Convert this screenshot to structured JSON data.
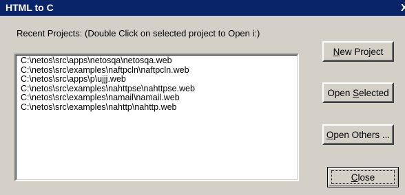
{
  "window": {
    "title": "HTML to C",
    "close_glyph": "X"
  },
  "prompt": "Recent Projects: (Double Click on selected project to Open i:)",
  "projects": [
    "C:\\netos\\src\\apps\\netosqa\\netosqa.web",
    "C:\\netos\\src\\examples\\naftpcln\\naftpcln.web",
    "C:\\netos\\src\\apps\\p\\ujjj.web",
    "C:\\netos\\src\\examples\\nahttpse\\nahttpse.web",
    "C:\\netos\\src\\examples\\namail\\namail.web",
    "C:\\netos\\src\\examples\\nahttp\\nahttp.web"
  ],
  "buttons": {
    "new_project": {
      "mnemonic": "N",
      "rest": "ew Project"
    },
    "open_selected": {
      "pre": "Open ",
      "mnemonic": "S",
      "rest": "elected"
    },
    "open_others": {
      "mnemonic": "O",
      "rest": "pen Others ..."
    },
    "close": {
      "mnemonic": "C",
      "rest": "lose"
    }
  },
  "colors": {
    "titlebar": "#0a246a",
    "face": "#d4d0c8"
  }
}
